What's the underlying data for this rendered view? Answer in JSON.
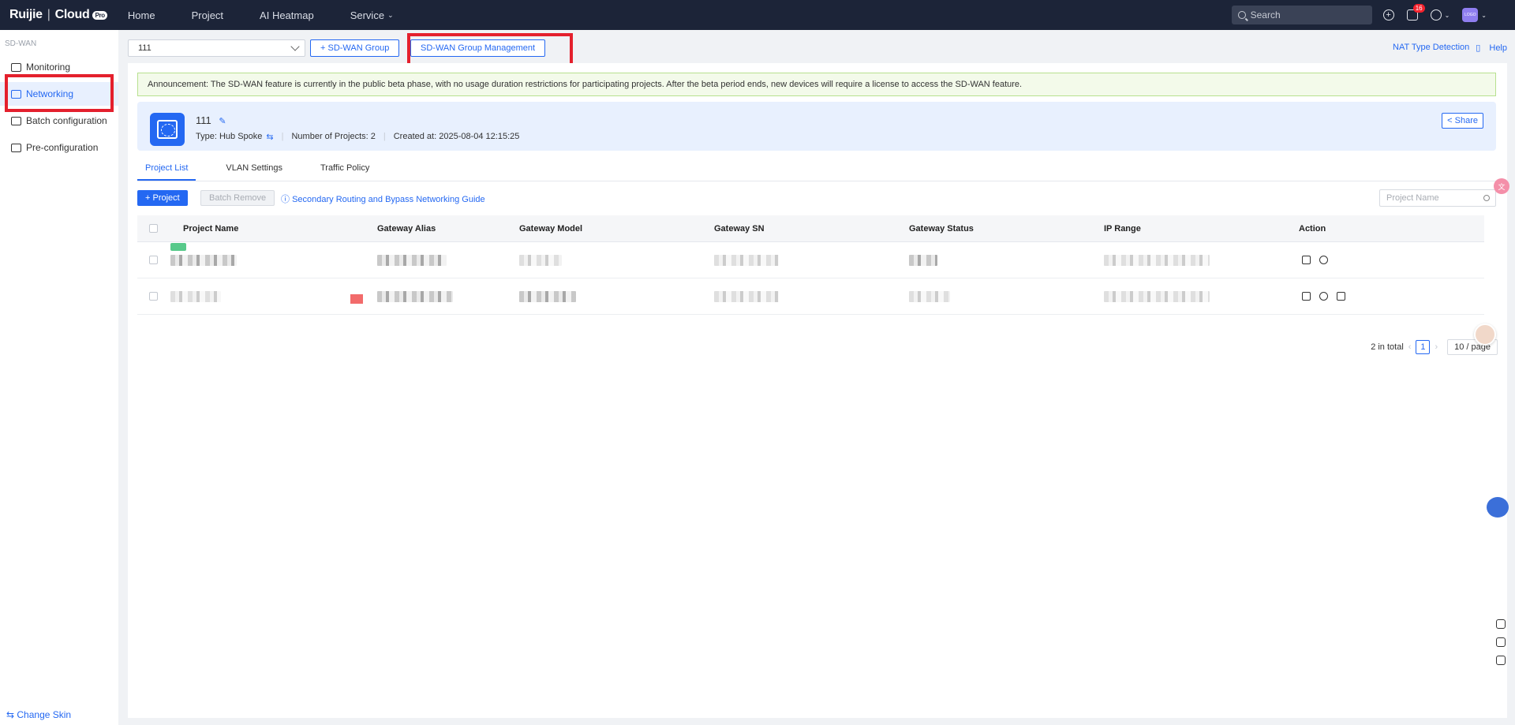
{
  "topbar": {
    "brand": "Ruijie",
    "brand_sub": "Cloud",
    "brand_badge": "Pro",
    "nav": [
      "Home",
      "Project",
      "AI Heatmap",
      "Service"
    ],
    "search_placeholder": "Search",
    "notification_count": "16",
    "avatar_text": "LOGO"
  },
  "sidebar": {
    "section": "SD-WAN",
    "items": [
      "Monitoring",
      "Networking",
      "Batch configuration",
      "Pre-configuration"
    ],
    "active_index": 1,
    "change_skin": "Change Skin"
  },
  "toolbar": {
    "group_select_value": "111",
    "add_group_button": "+ SD-WAN Group",
    "manage_button": "SD-WAN Group Management",
    "nat_link": "NAT Type Detection",
    "help_link": "Help"
  },
  "announcement": "Announcement:  The SD-WAN feature is currently in the public beta phase, with no usage duration restrictions for participating projects. After the beta period ends, new devices will require a license to access the SD-WAN feature.",
  "group": {
    "name": "111",
    "type_label": "Type:",
    "type_value": "Hub Spoke",
    "projects_label": "Number of Projects:",
    "projects_value": "2",
    "created_label": "Created at:",
    "created_value": "2025-08-04 12:15:25",
    "share_button": "Share"
  },
  "tabs": [
    "Project List",
    "VLAN Settings",
    "Traffic Policy"
  ],
  "list_toolbar": {
    "add_project": "+ Project",
    "batch_remove": "Batch Remove",
    "guide_link": "Secondary Routing and Bypass Networking Guide",
    "search_placeholder": "Project Name"
  },
  "table": {
    "columns": [
      "Project Name",
      "Gateway Alias",
      "Gateway Model",
      "Gateway SN",
      "Gateway Status",
      "IP Range",
      "Action"
    ]
  },
  "pagination": {
    "total_text": "2 in total",
    "current_page": "1",
    "page_size": "10 / page"
  },
  "colors": {
    "accent": "#2468f2",
    "topbar": "#1c2438",
    "highlight": "#e4202d",
    "announce_bg": "#f3faea"
  }
}
